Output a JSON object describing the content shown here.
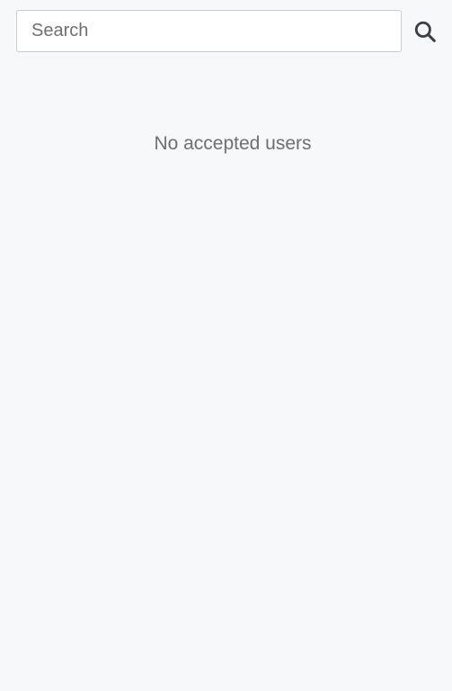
{
  "search": {
    "placeholder": "Search",
    "value": "",
    "icon": "search-icon"
  },
  "empty_state": {
    "message": "No accepted users"
  },
  "colors": {
    "background": "#f6f8fa",
    "input_border": "#c9cdd1",
    "text_muted": "#6c7075",
    "icon": "#3a3f44"
  }
}
